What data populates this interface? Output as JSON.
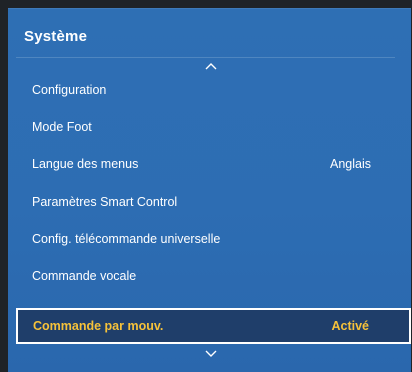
{
  "menu": {
    "title": "Système",
    "items": [
      {
        "label": "Configuration",
        "value": ""
      },
      {
        "label": "Mode Foot",
        "value": ""
      },
      {
        "label": "Langue des menus",
        "value": "Anglais"
      },
      {
        "label": "Paramètres Smart Control",
        "value": ""
      },
      {
        "label": "Config. télécommande universelle",
        "value": ""
      },
      {
        "label": "Commande vocale",
        "value": ""
      },
      {
        "label": "Commande par mouv.",
        "value": "Activé"
      }
    ]
  },
  "icons": {
    "scroll_up": "chevron-up-icon",
    "scroll_down": "chevron-down-icon"
  },
  "colors": {
    "panel": "#2e6fb4",
    "selected_bg": "#1f3e6a",
    "selected_text": "#f6c23a",
    "text": "#ffffff"
  }
}
